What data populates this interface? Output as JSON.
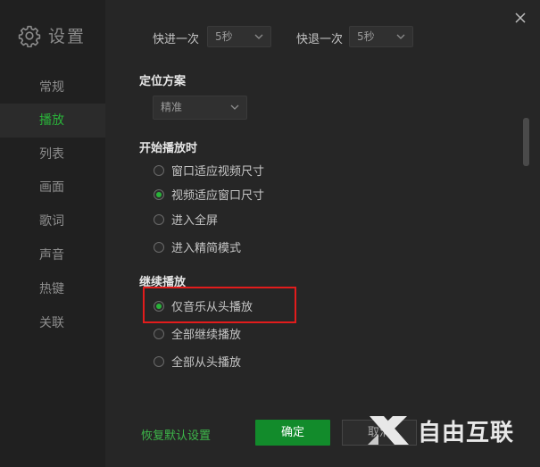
{
  "app": {
    "title": "设置"
  },
  "sidebar": {
    "items": [
      {
        "label": "常规",
        "active": false
      },
      {
        "label": "播放",
        "active": true
      },
      {
        "label": "列表",
        "active": false
      },
      {
        "label": "画面",
        "active": false
      },
      {
        "label": "歌词",
        "active": false
      },
      {
        "label": "声音",
        "active": false
      },
      {
        "label": "热键",
        "active": false
      },
      {
        "label": "关联",
        "active": false
      }
    ]
  },
  "seek": {
    "forward_label": "快进一次",
    "forward_value": "5秒",
    "backward_label": "快退一次",
    "backward_value": "5秒"
  },
  "positioning": {
    "title": "定位方案",
    "value": "精准"
  },
  "start_playback": {
    "title": "开始播放时",
    "options": [
      {
        "label": "窗口适应视频尺寸",
        "checked": false
      },
      {
        "label": "视频适应窗口尺寸",
        "checked": true
      },
      {
        "label": "进入全屏",
        "checked": false
      },
      {
        "label": "进入精简模式",
        "checked": false
      }
    ]
  },
  "continue_playback": {
    "title": "继续播放",
    "options": [
      {
        "label": "仅音乐从头播放",
        "checked": true
      },
      {
        "label": "全部继续播放",
        "checked": false
      },
      {
        "label": "全部从头播放",
        "checked": false
      }
    ]
  },
  "footer": {
    "restore_label": "恢复默认设置",
    "ok_label": "确定",
    "cancel_label": "取消"
  },
  "watermark": {
    "text": "自由互联"
  },
  "colors": {
    "accent": "#2ab33a",
    "highlight": "#e21c1c",
    "ok_button": "#128b2b"
  },
  "icons": {
    "title": "gear-icon",
    "close": "close-icon",
    "dropdown": "chevron-down-icon",
    "watermark": "x-logo-icon"
  }
}
